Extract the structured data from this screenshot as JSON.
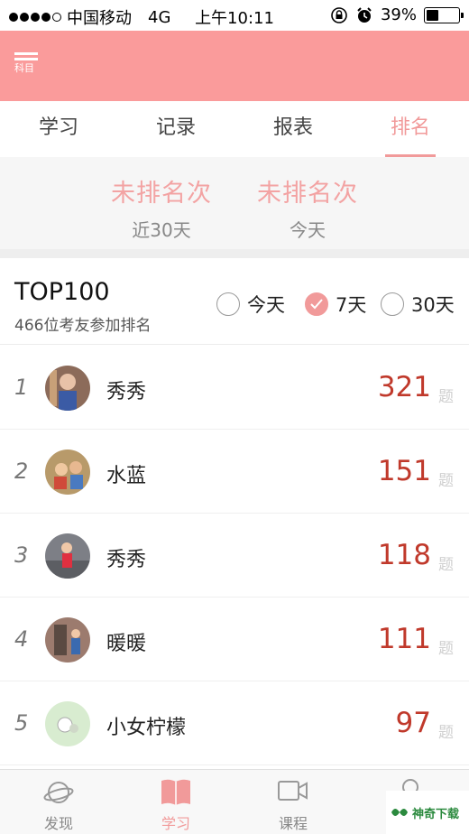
{
  "status_bar": {
    "carrier": "中国移动",
    "network": "4G",
    "time": "上午10:11",
    "battery_percent": "39%",
    "battery_level": 0.39,
    "signal_bars": 4
  },
  "header": {
    "menu_label": "科目"
  },
  "tabs": [
    {
      "label": "学习",
      "active": false
    },
    {
      "label": "记录",
      "active": false
    },
    {
      "label": "报表",
      "active": false
    },
    {
      "label": "排名",
      "active": true
    }
  ],
  "summary": [
    {
      "rank": "未排名次",
      "period": "近30天"
    },
    {
      "rank": "未排名次",
      "period": "今天"
    }
  ],
  "ranking": {
    "title": "TOP100",
    "subtitle": "466位考友参加排名",
    "filters": [
      {
        "label": "今天",
        "checked": false
      },
      {
        "label": "7天",
        "checked": true
      },
      {
        "label": "30天",
        "checked": false
      }
    ],
    "rows": [
      {
        "num": "1",
        "name": "秀秀",
        "count": "321",
        "unit": "题",
        "avatar_color": "#8c6b5a"
      },
      {
        "num": "2",
        "name": "水蓝",
        "count": "151",
        "unit": "题",
        "avatar_color": "#b89a6a"
      },
      {
        "num": "3",
        "name": "秀秀",
        "count": "118",
        "unit": "题",
        "avatar_color": "#7d7f86"
      },
      {
        "num": "4",
        "name": "暖暖",
        "count": "111",
        "unit": "题",
        "avatar_color": "#9c7b6e"
      },
      {
        "num": "5",
        "name": "小女柠檬",
        "count": "97",
        "unit": "题",
        "avatar_color": "#d8ecd0"
      }
    ]
  },
  "bottom_nav": [
    {
      "label": "发现",
      "icon": "planet-icon",
      "active": false
    },
    {
      "label": "学习",
      "icon": "book-icon",
      "active": true
    },
    {
      "label": "课程",
      "icon": "video-camera-icon",
      "active": false
    },
    {
      "label": "",
      "icon": "user-icon",
      "active": false
    }
  ],
  "watermark": {
    "text": "神奇下载"
  },
  "colors": {
    "accent": "#fa9b9b",
    "accent_text": "#f19a9a",
    "count_red": "#c0392b"
  }
}
